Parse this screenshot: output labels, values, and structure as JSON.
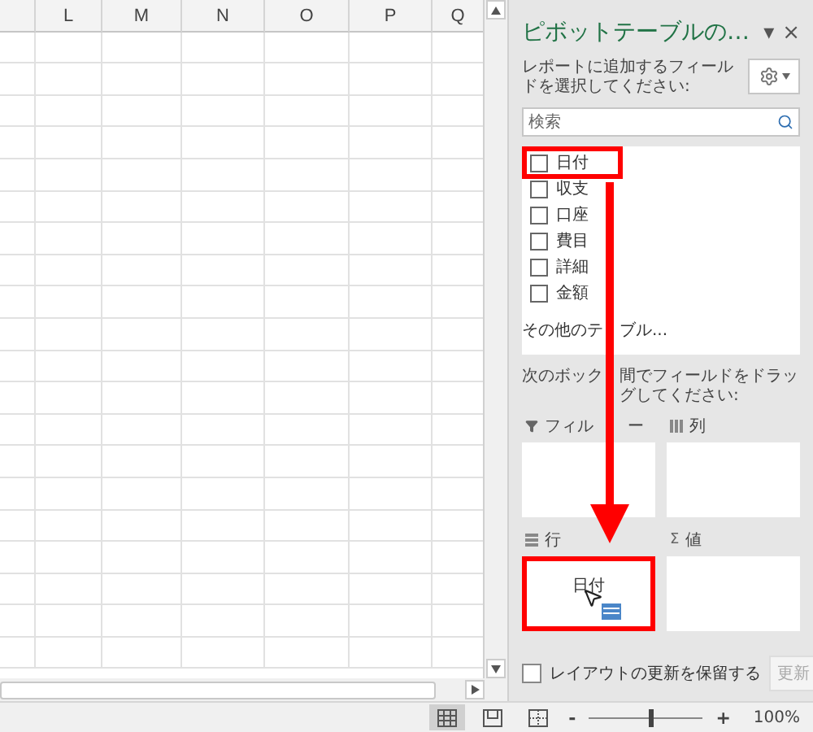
{
  "sheet": {
    "columns": [
      "L",
      "M",
      "N",
      "O",
      "P",
      "Q"
    ]
  },
  "pane": {
    "title": "ピボットテーブルの…",
    "menu_caret": "▾",
    "close": "×",
    "description": "レポートに追加するフィールドを選択してください:",
    "search": {
      "placeholder": "検索"
    },
    "fields": [
      {
        "label": "日付",
        "checked": false,
        "highlighted": true
      },
      {
        "label": "収支",
        "checked": false,
        "highlighted": false
      },
      {
        "label": "口座",
        "checked": false,
        "highlighted": false
      },
      {
        "label": "費目",
        "checked": false,
        "highlighted": false
      },
      {
        "label": "詳細",
        "checked": false,
        "highlighted": false
      },
      {
        "label": "金額",
        "checked": false,
        "highlighted": false
      }
    ],
    "more_tables": [
      "その他のテ",
      "ブル..."
    ],
    "drag_hint": [
      "次のボック",
      "間でフィールドをドラッグしてください:"
    ],
    "areas": [
      {
        "kind": "filter",
        "label_parts": [
          "フィル",
          "ー"
        ],
        "highlighted": false
      },
      {
        "kind": "columns",
        "label_parts": [
          "列"
        ],
        "highlighted": false
      },
      {
        "kind": "rows",
        "label_parts": [
          "行"
        ],
        "highlighted": true,
        "dragging_label": "日付"
      },
      {
        "kind": "values",
        "symbol": "Σ",
        "label_parts": [
          "値"
        ],
        "highlighted": false
      }
    ],
    "defer_update": {
      "label": "レイアウトの更新を保留する",
      "checked": false
    },
    "update_button": {
      "label": "更新",
      "disabled": true
    }
  },
  "status_bar": {
    "views": [
      {
        "kind": "normal",
        "selected": true
      },
      {
        "kind": "page_layout",
        "selected": false
      },
      {
        "kind": "page_break",
        "selected": false
      }
    ],
    "zoom": {
      "minus": "-",
      "plus": "+",
      "level": 0.55,
      "reading": "100%"
    }
  }
}
